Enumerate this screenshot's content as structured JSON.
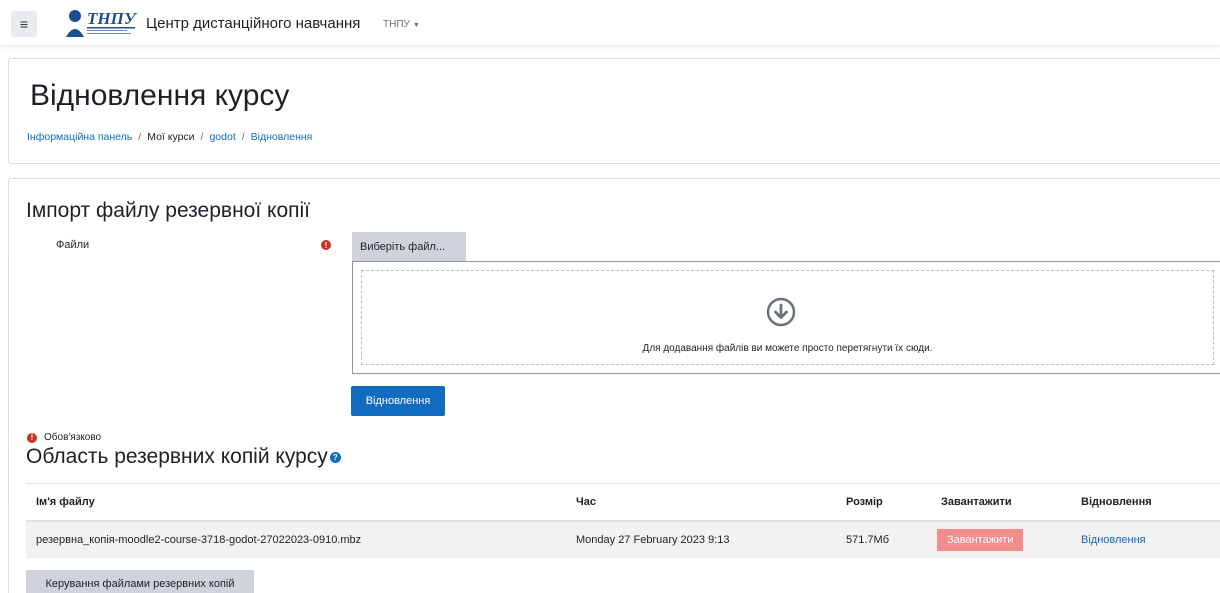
{
  "navbar": {
    "menu_icon": "hamburger-icon",
    "logo_text": "ТНПУ",
    "site_name": "Центр дистанційного навчання",
    "lang": "ТНПУ"
  },
  "header": {
    "title": "Відновлення курсу",
    "breadcrumb": [
      "Інформаційна панель",
      "Мої курси",
      "godot",
      "Відновлення"
    ]
  },
  "import": {
    "title": "Імпорт файлу резервної копії",
    "files_label": "Файли",
    "choose_button": "Виберіть файл...",
    "drop_text": "Для додавання файлів ви можете просто перетягнути їх сюди.",
    "restore_button": "Відновлення",
    "required_note": "Обов'язково"
  },
  "backups": {
    "title": "Область резервних копій курсу",
    "columns": [
      "Ім'я файлу",
      "Час",
      "Розмір",
      "Завантажити",
      "Відновлення"
    ],
    "rows": [
      {
        "filename": "резервна_копія-moodle2-course-3718-godot-27022023-0910.mbz",
        "time": "Monday 27 February 2023 9:13",
        "size": "571.7Мб",
        "download": "Завантажити",
        "restore": "Відновлення"
      }
    ],
    "manage_button": "Керування файлами резервних копій"
  },
  "colors": {
    "primary": "#0f6cbf",
    "danger": "#ca3120",
    "download_highlight": "#f28b8b",
    "secondary_button": "#ced4da"
  }
}
